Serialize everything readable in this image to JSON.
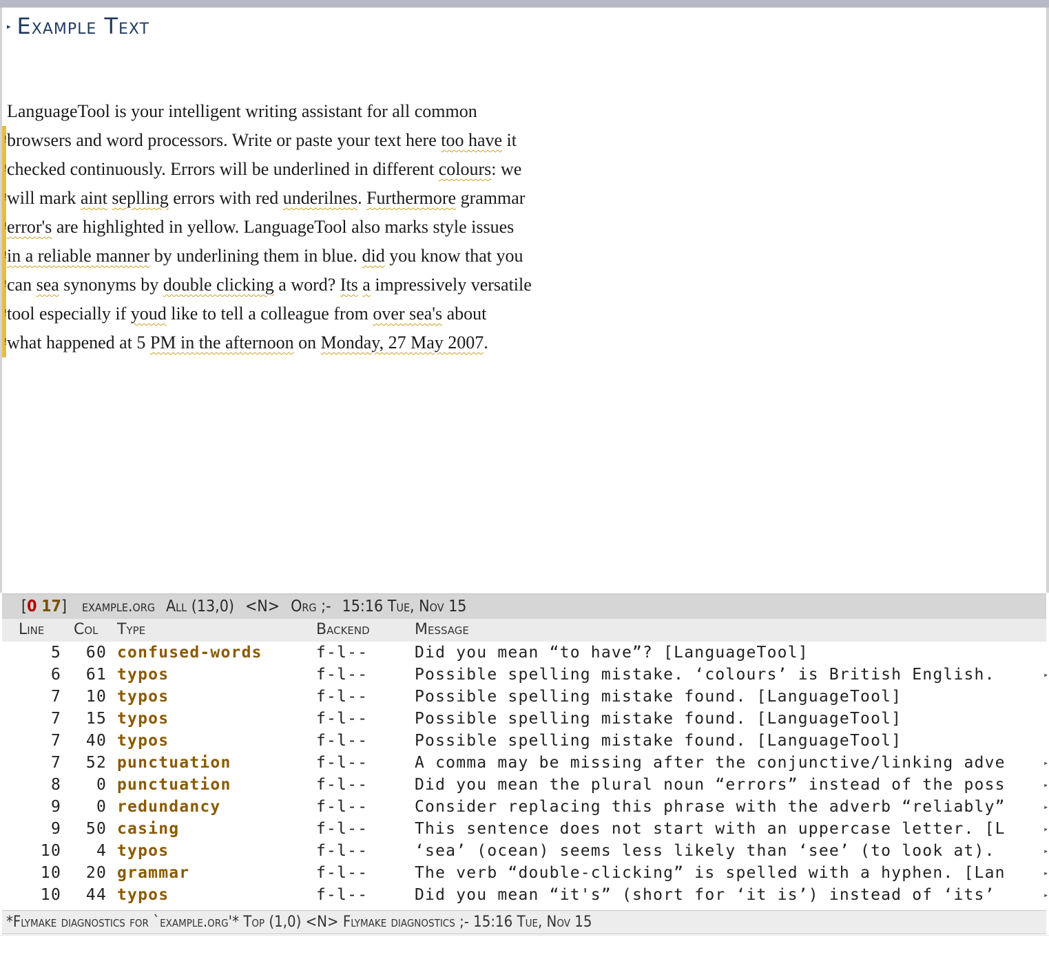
{
  "heading": {
    "bullet": "▸",
    "title": "Example Text"
  },
  "text_lines": [
    [
      {
        "t": "LanguageTool is your intelligent writing assistant for all common"
      }
    ],
    [
      {
        "t": "browsers and word processors. Write or paste your text here "
      },
      {
        "t": "too have",
        "err": true
      },
      {
        "t": " it"
      }
    ],
    [
      {
        "t": "checked continuously. Errors will be underlined in different "
      },
      {
        "t": "colours",
        "err": true
      },
      {
        "t": ": we"
      }
    ],
    [
      {
        "t": "will mark "
      },
      {
        "t": "aint",
        "err": true
      },
      {
        "t": " "
      },
      {
        "t": "seplling",
        "err": true
      },
      {
        "t": " errors with red "
      },
      {
        "t": "underilnes",
        "err": true
      },
      {
        "t": ". "
      },
      {
        "t": "Furthermore",
        "err": true
      },
      {
        "t": " grammar"
      }
    ],
    [
      {
        "t": "error's",
        "err": true
      },
      {
        "t": " are highlighted in yellow. LanguageTool also marks style issues"
      }
    ],
    [
      {
        "t": "in a reliable manner",
        "err": true
      },
      {
        "t": " by underlining them in blue. "
      },
      {
        "t": "did",
        "err": true
      },
      {
        "t": " you know that you"
      }
    ],
    [
      {
        "t": "can "
      },
      {
        "t": "sea",
        "err": true
      },
      {
        "t": " synonyms by "
      },
      {
        "t": "double clicking",
        "err": true
      },
      {
        "t": " a word? "
      },
      {
        "t": "Its",
        "err": true
      },
      {
        "t": " "
      },
      {
        "t": "a",
        "err": true
      },
      {
        "t": " impressively versatile"
      }
    ],
    [
      {
        "t": "tool especially if "
      },
      {
        "t": "youd",
        "err": true
      },
      {
        "t": " like to tell a colleague from "
      },
      {
        "t": "over sea's",
        "err": true
      },
      {
        "t": " about"
      }
    ],
    [
      {
        "t": "what happened at 5 "
      },
      {
        "t": "PM in the afternoon",
        "err": true
      },
      {
        "t": " on "
      },
      {
        "t": "Monday, 27 May 2007",
        "err": true
      },
      {
        "t": "."
      }
    ]
  ],
  "fringe": {
    "mark": "!",
    "color": "#e6bd42"
  },
  "modeline": {
    "open_bracket": "[",
    "errors": "0",
    "warnings": "17",
    "close_bracket": "]",
    "buffer": "example.org",
    "position": "All (13,0)",
    "state": "<N>",
    "mode": "Org ;-",
    "time": "15:16 Tue, Nov 15"
  },
  "table": {
    "headers": {
      "line": "Line",
      "col": "Col",
      "type": "Type",
      "backend": "Backend",
      "message": "Message"
    },
    "rows": [
      {
        "line": "5",
        "col": "60",
        "type": "confused-words",
        "backend": "f-l--",
        "message": "Did you mean “to have”? [LanguageTool]",
        "cont": false
      },
      {
        "line": "6",
        "col": "61",
        "type": "typos",
        "backend": "f-l--",
        "message": "Possible spelling mistake. ‘colours’ is British English.",
        "cont": true
      },
      {
        "line": "7",
        "col": "10",
        "type": "typos",
        "backend": "f-l--",
        "message": "Possible spelling mistake found. [LanguageTool]",
        "cont": false
      },
      {
        "line": "7",
        "col": "15",
        "type": "typos",
        "backend": "f-l--",
        "message": "Possible spelling mistake found. [LanguageTool]",
        "cont": false
      },
      {
        "line": "7",
        "col": "40",
        "type": "typos",
        "backend": "f-l--",
        "message": "Possible spelling mistake found. [LanguageTool]",
        "cont": false
      },
      {
        "line": "7",
        "col": "52",
        "type": "punctuation",
        "backend": "f-l--",
        "message": "A comma may be missing after the conjunctive/linking adve",
        "cont": true
      },
      {
        "line": "8",
        "col": "0",
        "type": "punctuation",
        "backend": "f-l--",
        "message": "Did you mean the plural noun “errors” instead of the poss",
        "cont": true
      },
      {
        "line": "9",
        "col": "0",
        "type": "redundancy",
        "backend": "f-l--",
        "message": "Consider replacing this phrase with the adverb “reliably”",
        "cont": true
      },
      {
        "line": "9",
        "col": "50",
        "type": "casing",
        "backend": "f-l--",
        "message": "This sentence does not start with an uppercase letter. [L",
        "cont": true
      },
      {
        "line": "10",
        "col": "4",
        "type": "typos",
        "backend": "f-l--",
        "message": "‘sea’ (ocean) seems less likely than ‘see’ (to look at).",
        "cont": true
      },
      {
        "line": "10",
        "col": "20",
        "type": "grammar",
        "backend": "f-l--",
        "message": "The verb “double-clicking” is spelled with a hyphen. [Lan",
        "cont": true
      },
      {
        "line": "10",
        "col": "44",
        "type": "typos",
        "backend": "f-l--",
        "message": "Did you mean “it's” (short for ‘it is’) instead of ‘its’",
        "cont": true
      }
    ],
    "continuation_glyph": "▸"
  },
  "modeline2": {
    "text": "*Flymake diagnostics for `example.org'* Top (1,0) <N> Flymake diagnostics ;- 15:16 Tue, Nov 15"
  },
  "colors": {
    "heading": "#1f3a5f",
    "error_underline": "#c9a227",
    "type_column": "#8a5a00",
    "modeline_error_count": "#b30000"
  }
}
